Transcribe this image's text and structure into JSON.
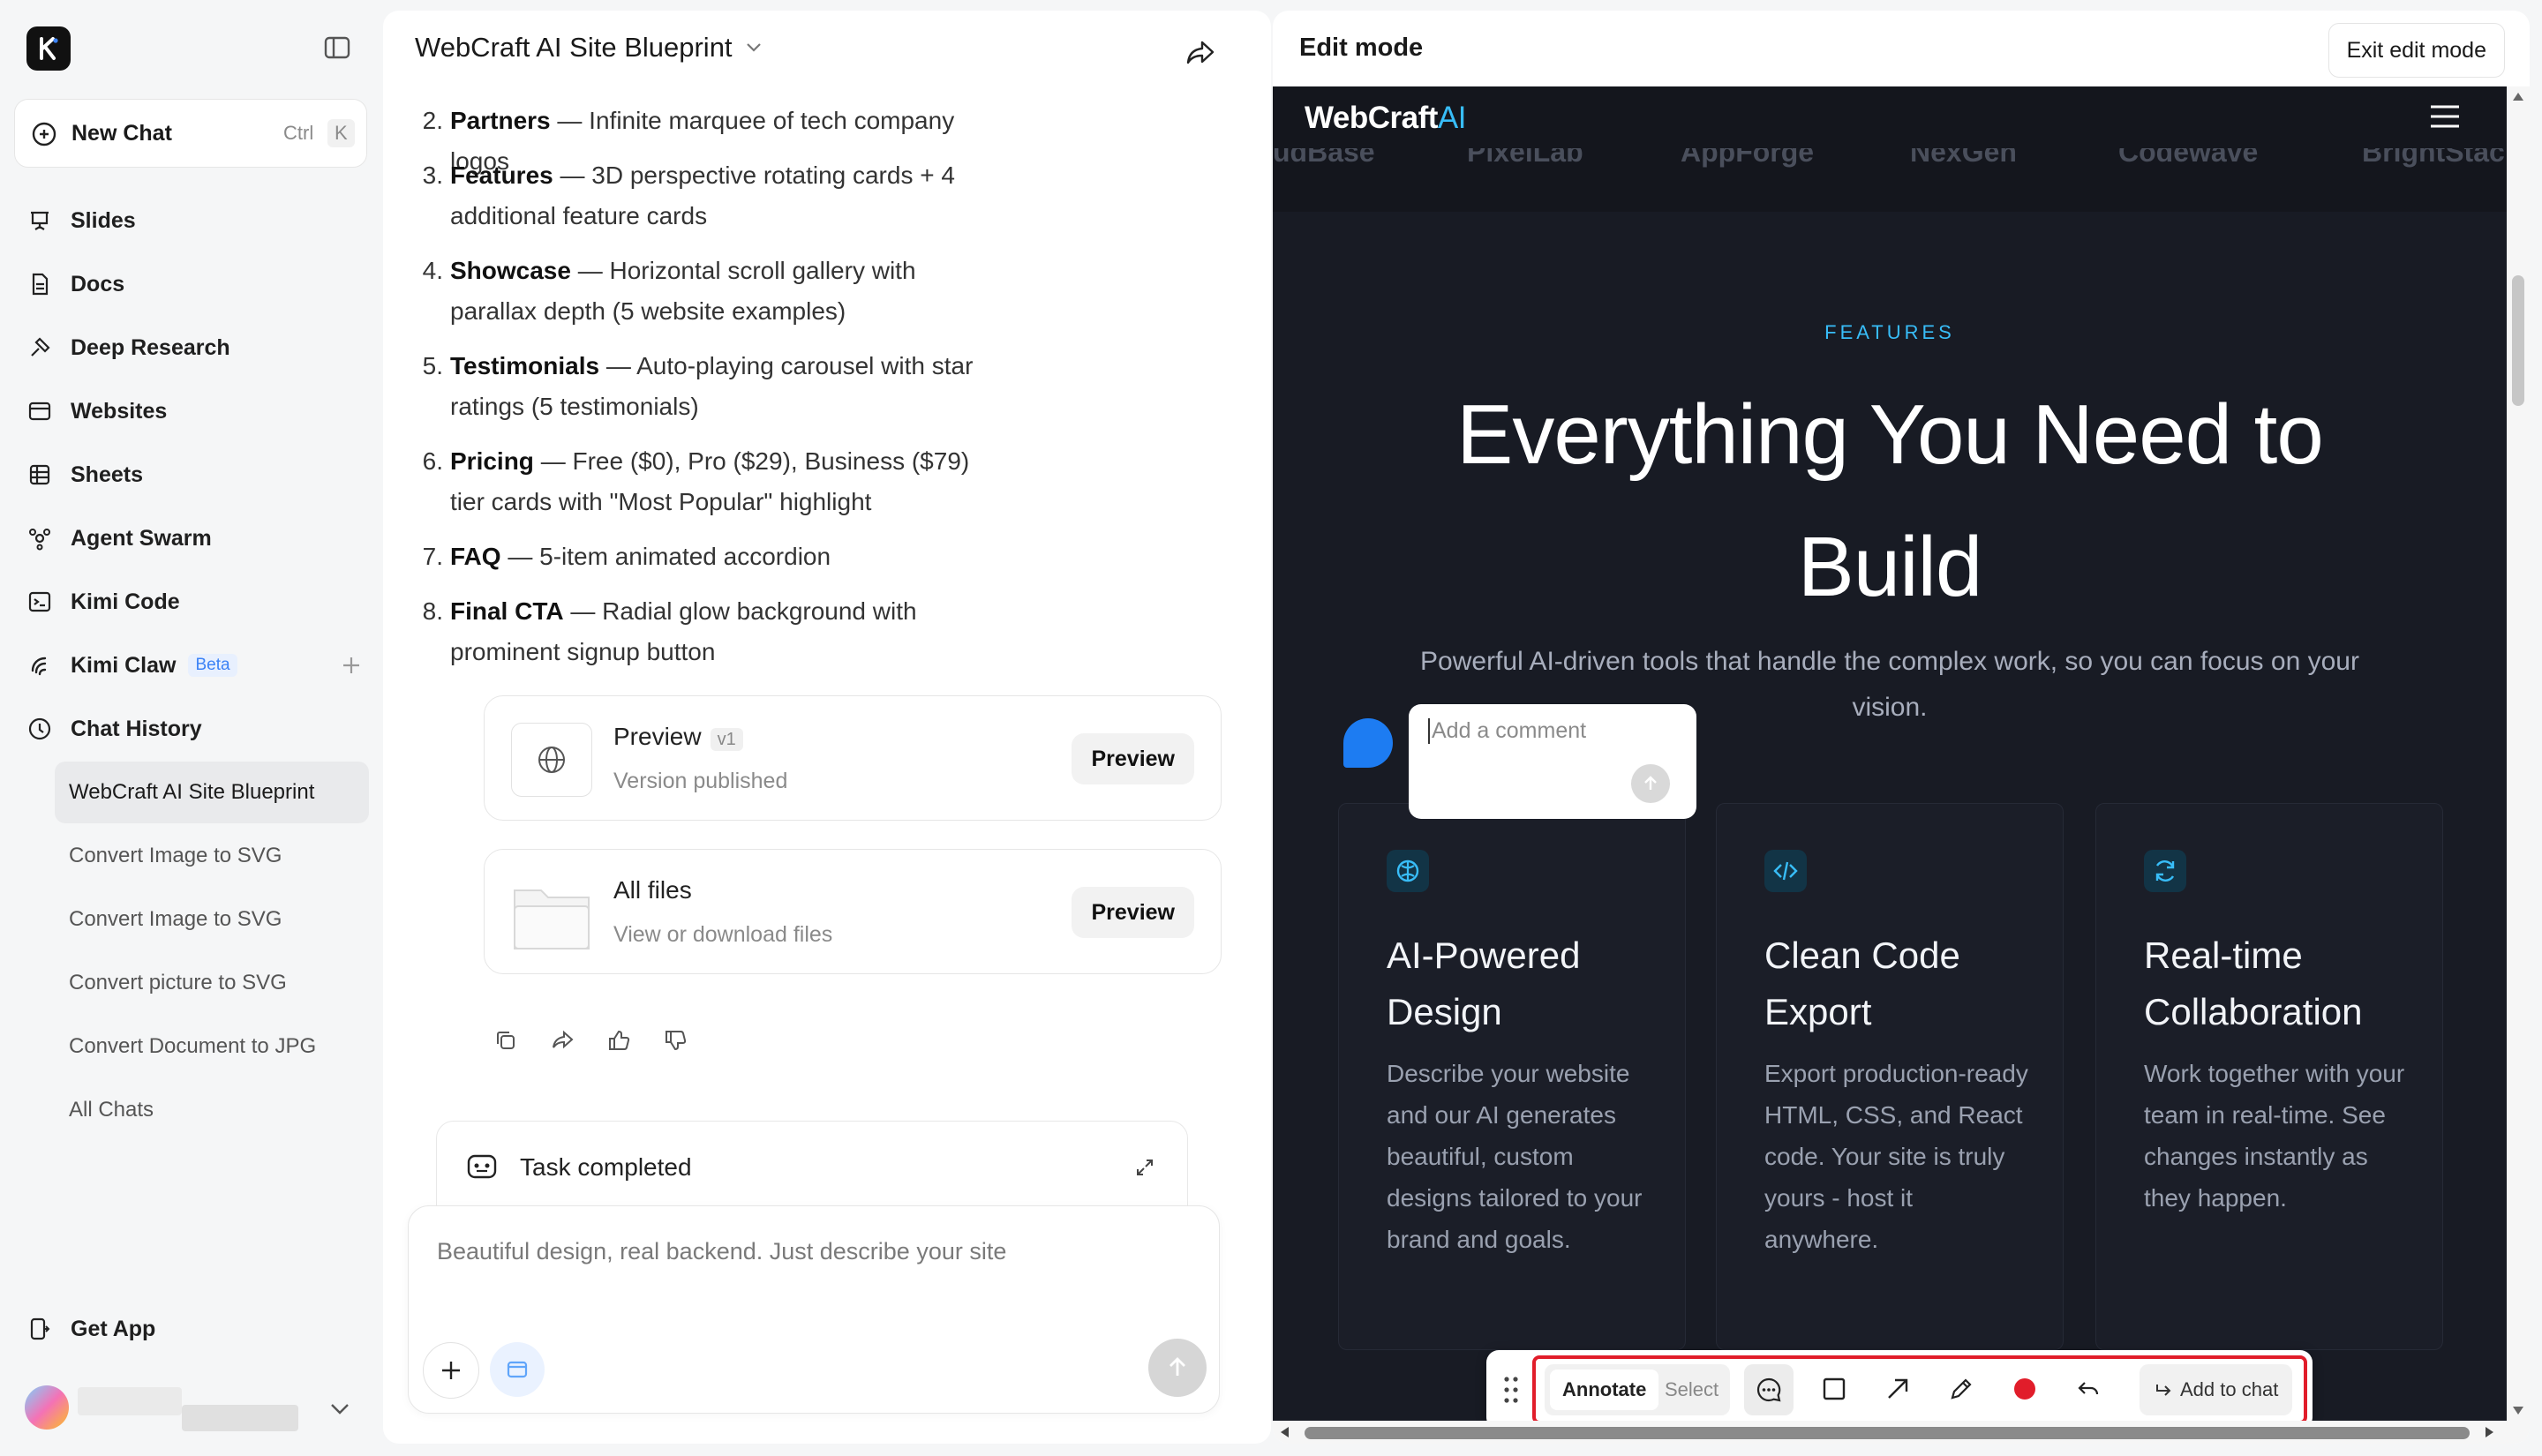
{
  "sidebar": {
    "new_chat": "New Chat",
    "shortcut_ctrl": "Ctrl",
    "shortcut_key": "K",
    "nav": [
      {
        "label": "Slides"
      },
      {
        "label": "Docs"
      },
      {
        "label": "Deep Research"
      },
      {
        "label": "Websites"
      },
      {
        "label": "Sheets"
      },
      {
        "label": "Agent Swarm"
      },
      {
        "label": "Kimi Code"
      },
      {
        "label": "Kimi Claw",
        "badge": "Beta"
      },
      {
        "label": "Chat History"
      }
    ],
    "history": [
      "WebCraft AI Site Blueprint",
      "Convert Image to SVG",
      "Convert Image to SVG",
      "Convert picture to SVG",
      "Convert Document to JPG",
      "All Chats"
    ],
    "get_app": "Get App"
  },
  "chat": {
    "title": "WebCraft AI Site Blueprint",
    "list": [
      {
        "num": "2.",
        "bold": "Partners",
        "text": " — Infinite marquee of tech company logos"
      },
      {
        "num": "3.",
        "bold": "Features",
        "text": " — 3D perspective rotating cards + 4 additional feature cards"
      },
      {
        "num": "4.",
        "bold": "Showcase",
        "text": " — Horizontal scroll gallery with parallax depth (5 website examples)"
      },
      {
        "num": "5.",
        "bold": "Testimonials",
        "text": " — Auto-playing carousel with star ratings (5 testimonials)"
      },
      {
        "num": "6.",
        "bold": "Pricing",
        "text": " — Free ($0), Pro ($29), Business ($79) tier cards with \"Most Popular\" highlight"
      },
      {
        "num": "7.",
        "bold": "FAQ",
        "text": " — 5-item animated accordion"
      },
      {
        "num": "8.",
        "bold": "Final CTA",
        "text": " — Radial glow background with prominent signup button"
      }
    ],
    "preview_card": {
      "title": "Preview",
      "version": "v1",
      "subtitle": "Version published",
      "button": "Preview"
    },
    "files_card": {
      "title": "All files",
      "subtitle": "View or download files",
      "button": "Preview"
    },
    "task_status": "Task completed",
    "composer_placeholder": "Beautiful design, real backend. Just describe your site"
  },
  "panel": {
    "title": "Edit mode",
    "exit_button": "Exit edit mode",
    "site": {
      "brand_main": "WebCraft",
      "brand_accent": "AI",
      "marquee": [
        "udBase",
        "PixelLab",
        "AppForge",
        "NexGen",
        "Codewave",
        "BrightStac"
      ],
      "eyebrow": "FEATURES",
      "headline": "Everything You Need to Build",
      "subline": "Powerful AI-driven tools that handle the complex work, so you can focus on your vision.",
      "cards": [
        {
          "title": "AI-Powered Design",
          "desc": "Describe your website and our AI generates beautiful, custom designs tailored to your brand and goals.",
          "icon": "brain-icon"
        },
        {
          "title": "Clean Code Export",
          "desc": "Export production-ready HTML, CSS, and React code. Your site is truly yours - host it anywhere.",
          "icon": "code-icon"
        },
        {
          "title": "Real-time Collaboration",
          "desc": "Work together with your team in real-time. See changes instantly as they happen.",
          "icon": "sync-icon"
        }
      ],
      "accent_color": "#38bdf8"
    },
    "comment_placeholder": "Add a comment",
    "toolbar": {
      "annotate": "Annotate",
      "select": "Select",
      "add_to_chat": "Add to chat",
      "record_color": "#e11d2a"
    }
  }
}
